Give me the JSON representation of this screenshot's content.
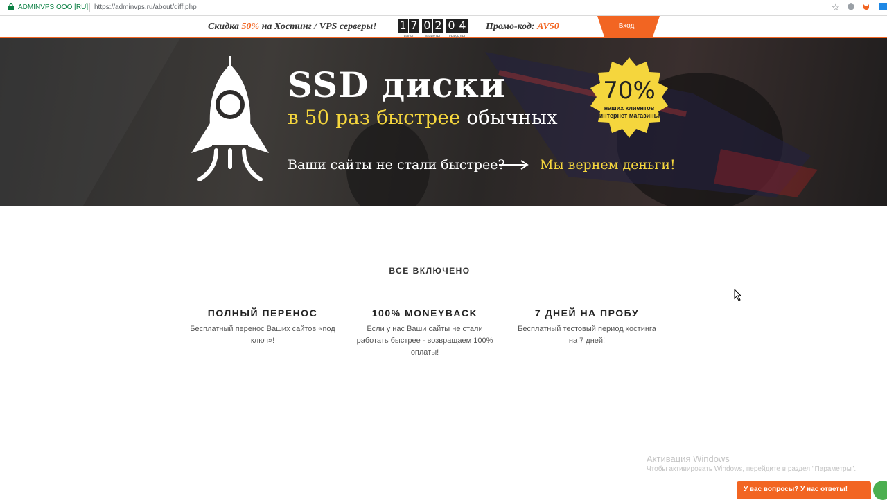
{
  "browser": {
    "secure_label": "ADMINVPS OOO [RU]",
    "url": "https://adminvps.ru/about/diff.php"
  },
  "promo": {
    "discount_prefix": "Скидка ",
    "discount_value": "50%",
    "discount_suffix": " на Хостинг / VPS серверы!",
    "timer": {
      "hours": [
        "1",
        "7"
      ],
      "minutes": [
        "0",
        "2"
      ],
      "seconds": [
        "0",
        "4"
      ],
      "hours_label": "часы",
      "minutes_label": "минуты",
      "seconds_label": "секунды"
    },
    "code_label": "Промо-код: ",
    "code_value": "AV50",
    "login_label": "Вход"
  },
  "hero": {
    "title": "SSD диски",
    "subtitle_highlight": "в 50 раз быстрее",
    "subtitle_rest": " обычных",
    "question": "Ваши сайты не стали быстрее?",
    "guarantee": "Мы вернем деньги!",
    "badge_percent": "70%",
    "badge_text": "наших клиентов интернет магазины"
  },
  "features": {
    "section_title": "ВСЕ ВКЛЮЧЕНО",
    "items": [
      {
        "title": "ПОЛНЫЙ ПЕРЕНОС",
        "text": "Бесплатный перенос Ваших сайтов «под ключ»!"
      },
      {
        "title": "100% MONEYBACK",
        "text": "Если у нас Ваши сайты не стали работать быстрее - возвращаем 100% оплаты!"
      },
      {
        "title": "7 ДНЕЙ НА ПРОБУ",
        "text": "Бесплатный тестовый период хостинга на 7 дней!"
      }
    ]
  },
  "watermark": {
    "line1": "Активация Windows",
    "line2": "Чтобы активировать Windows, перейдите в раздел \"Параметры\"."
  },
  "chat": {
    "label": "У вас вопросы? У нас ответы!"
  },
  "colors": {
    "accent": "#f26522",
    "highlight": "#f5d63d",
    "secure": "#0b8043"
  }
}
